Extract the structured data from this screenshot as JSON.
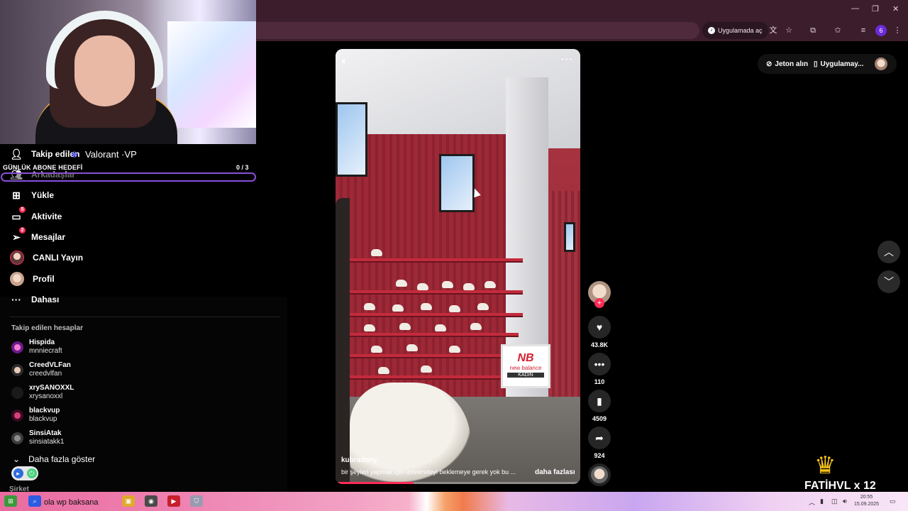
{
  "browser": {
    "open_in_app_label": "Uygulamada aç",
    "profile_badge": "6"
  },
  "overlay": {
    "game_label": "Valorant ·VP",
    "goal_label": "GÜNLÜK ABONE HEDEFİ",
    "goal_count": "0 / 3",
    "sub_text": "FATİHVL x 12"
  },
  "sidebar": {
    "items": [
      {
        "label": "Takip edilen"
      },
      {
        "label": "Arkadaşlar"
      },
      {
        "label": "Yükle"
      },
      {
        "label": "Aktivite",
        "badge": "5"
      },
      {
        "label": "Mesajlar",
        "badge": "2"
      },
      {
        "label": "CANLI Yayın"
      },
      {
        "label": "Profil"
      },
      {
        "label": "Dahası"
      }
    ],
    "following_title": "Takip edilen hesaplar",
    "accounts": [
      {
        "name": "Hispida",
        "handle": "mnniecraft"
      },
      {
        "name": "CreedVLFan",
        "handle": "creedvlfan"
      },
      {
        "name": "xrySANOXXL",
        "handle": "xrysanoxxl"
      },
      {
        "name": "blackvup",
        "handle": "blackvup"
      },
      {
        "name": "SinsiAtak",
        "handle": "sinsiatakk1"
      }
    ],
    "show_more": "Daha fazla göster",
    "company": "Şirket"
  },
  "video": {
    "author": "kubradeny",
    "caption": "bir şeyleri yapmak için üniversiteyi beklemeye gerek yok bu ...",
    "more_label": "daha fazlası",
    "store_brand": "new balance",
    "store_sign": "KADIN",
    "progress": 0.32
  },
  "actions": {
    "likes": "43.8K",
    "comments": "110",
    "saves": "4509",
    "shares": "924"
  },
  "top_right": {
    "coins_label": "Jeton alın",
    "app_label": "Uygulamay..."
  },
  "taskbar": {
    "ticker": "Ucuz Steam oyunları bu linkte! → gola wp baksana",
    "ticker_visible": "ola wp baksana",
    "time": "20:55",
    "date": "15.09.2025"
  },
  "colors": {
    "accent": "#fe2c55",
    "chrome": "#3b1d2c",
    "goal_border": "#8a4fd8"
  }
}
